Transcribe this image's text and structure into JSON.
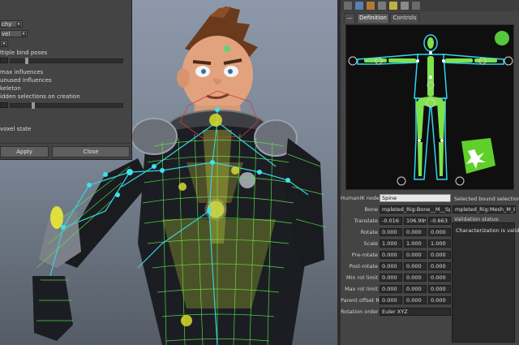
{
  "options_window": {
    "rows": [
      "chy",
      "vel",
      "ttiple bind poses",
      "max influences",
      "unused influences",
      "keleton",
      "idden selections on creation",
      "voxel state"
    ],
    "apply_label": "Apply",
    "close_label": "Close"
  },
  "panel": {
    "tabs": [
      "Definition",
      "Controls"
    ],
    "fields": {
      "humanik_node_label": "HumanIK node",
      "humanik_node_value": "Spine",
      "bone_label": "Bone",
      "bone_value": "mpleted_Rig:Bone__M__Spine_01",
      "translate_label": "Translate",
      "translate": [
        "-0.016",
        "106.999",
        "-0.663"
      ],
      "rotate_label": "Rotate",
      "rotate": [
        "0.000",
        "0.000",
        "0.000"
      ],
      "scale_label": "Scale",
      "scale": [
        "1.000",
        "1.000",
        "1.000"
      ],
      "prerotate_label": "Pre-rotate",
      "prerotate": [
        "0.000",
        "0.000",
        "0.000"
      ],
      "postrotate_label": "Post-rotate",
      "postrotate": [
        "0.000",
        "0.000",
        "0.000"
      ],
      "minrot_label": "Min rot limit",
      "minrot": [
        "0.000",
        "0.000",
        "0.000"
      ],
      "maxrot_label": "Max rot limit",
      "maxrot": [
        "0.000",
        "0.000",
        "0.000"
      ],
      "parent_offset_label": "Parent offset R",
      "parent_offset": [
        "0.000",
        "0.000",
        "0.000"
      ],
      "rotation_order_label": "Rotation order",
      "rotation_order_value": "Euler XYZ"
    },
    "selected_bound_label": "Selected bound selection",
    "selected_bound_value": "mpleted_Rig:Mesh_M_Body",
    "validation_label": "Validation status:",
    "validation_message": "Characterization is valid."
  },
  "colors": {
    "rig_green": "#55e84d",
    "joint_yellow": "#d6dd2c",
    "skeleton_cyan": "#35d3e0",
    "figure_bone": "#7fe24a",
    "figure_outline": "#2fd6f2",
    "logo_green": "#5fcf2a"
  },
  "icons": [
    "options-icon",
    "channel-box-icon",
    "attribute-icon",
    "tool-icon",
    "snap-icon",
    "lock-icon",
    "close-icon"
  ]
}
